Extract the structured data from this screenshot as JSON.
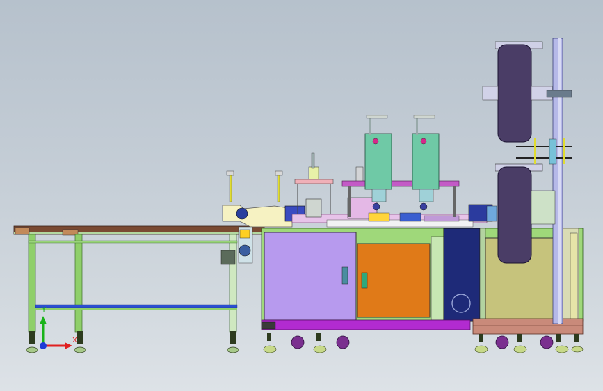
{
  "triad": {
    "x_label": "X",
    "y_label": "Y",
    "x_color": "#e02020",
    "y_color": "#19b319",
    "origin_color": "#1f3bd6"
  },
  "colors": {
    "frame": "#8fcf6a",
    "conveyor_top": "#7a4a32",
    "cabinet_left_door": "#b79aee",
    "cabinet_mid_door": "#e07a18",
    "cabinet_dark": "#1e2a78",
    "cabinet_right": "#c6c37c",
    "base_rail": "#b22bd0",
    "welder_head": "#6fc9a6",
    "roller": "#4a3d66",
    "caster": "#7a2f8f"
  }
}
